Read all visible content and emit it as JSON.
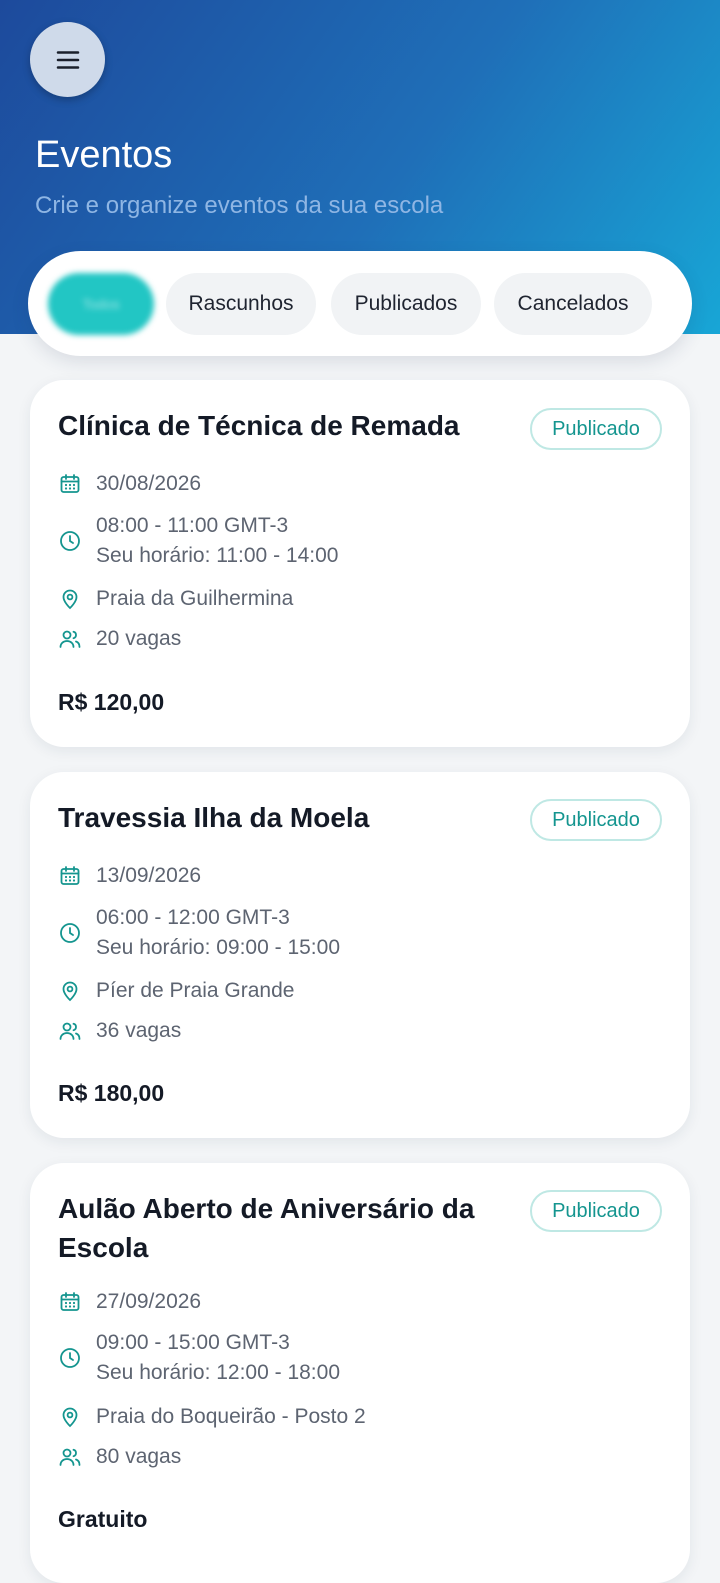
{
  "header": {
    "menu_icon": "hamburger-menu-icon",
    "title": "Eventos",
    "subtitle": "Crie e organize eventos da sua escola"
  },
  "filters": [
    {
      "label": "Todos",
      "active": true
    },
    {
      "label": "Rascunhos",
      "active": false
    },
    {
      "label": "Publicados",
      "active": false
    },
    {
      "label": "Cancelados",
      "active": false
    }
  ],
  "colors": {
    "accent": "#22c6c4",
    "icon": "#14958f",
    "badge_text": "#14958f",
    "header_start": "#1d4a9c",
    "header_end": "#18a6d6"
  },
  "events": [
    {
      "title": "Clínica de Técnica de Remada",
      "status": "Publicado",
      "date": "30/08/2026",
      "time": "08:00 - 11:00 GMT-3",
      "local_time": "Seu horário: 11:00 - 14:00",
      "location": "Praia da Guilhermina",
      "spots": "20 vagas",
      "price": "R$ 120,00"
    },
    {
      "title": "Travessia Ilha da Moela",
      "status": "Publicado",
      "date": "13/09/2026",
      "time": "06:00 - 12:00 GMT-3",
      "local_time": "Seu horário: 09:00 - 15:00",
      "location": "Píer de Praia Grande",
      "spots": "36 vagas",
      "price": "R$ 180,00"
    },
    {
      "title": "Aulão Aberto de Aniversário da Escola",
      "status": "Publicado",
      "date": "27/09/2026",
      "time": "09:00 - 15:00 GMT-3",
      "local_time": "Seu horário: 12:00 - 18:00",
      "location": "Praia do Boqueirão - Posto 2",
      "spots": "80 vagas",
      "price": "Gratuito"
    }
  ]
}
